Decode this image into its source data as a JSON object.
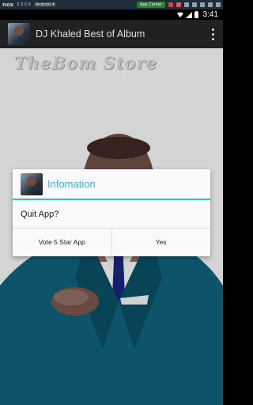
{
  "emulator": {
    "logo": "nox",
    "version": "6.3.0.8",
    "android_badge": "Android 4",
    "app_center_label": "App Center"
  },
  "status_bar": {
    "time": "3:41"
  },
  "action_bar": {
    "title": "DJ Khaled Best of Album"
  },
  "background": {
    "logo_text": "TheBom Store"
  },
  "dialog": {
    "title": "Infomation",
    "message": "Quit App?",
    "buttons": {
      "vote": "Vote 5 Star App",
      "yes": "Yes"
    }
  }
}
